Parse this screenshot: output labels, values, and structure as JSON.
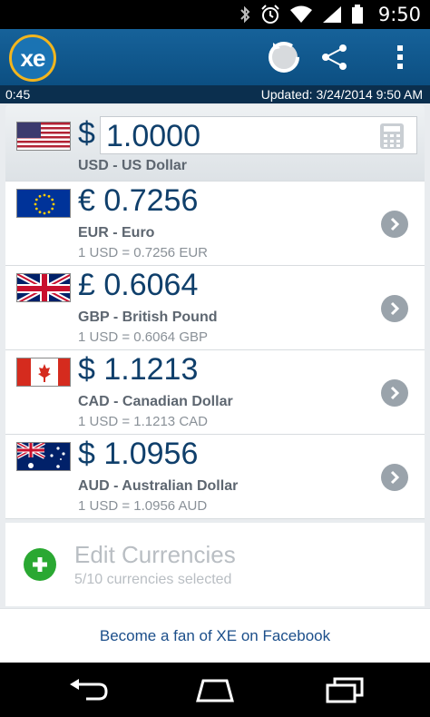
{
  "status_bar": {
    "time": "9:50"
  },
  "app_bar": {
    "logo_text": "xe"
  },
  "info_bar": {
    "left_text": "0:45",
    "updated_label": "Updated:",
    "updated_value": "3/24/2014 9:50 AM"
  },
  "base_currency": {
    "symbol": "$",
    "amount": "1.0000",
    "label": "USD - US Dollar"
  },
  "rows": [
    {
      "symbol_value": "€ 0.7256",
      "label": "EUR - Euro",
      "rate": "1 USD = 0.7256 EUR"
    },
    {
      "symbol_value": "£ 0.6064",
      "label": "GBP - British Pound",
      "rate": "1 USD = 0.6064 GBP"
    },
    {
      "symbol_value": "$ 1.1213",
      "label": "CAD - Canadian Dollar",
      "rate": "1 USD = 1.1213 CAD"
    },
    {
      "symbol_value": "$ 1.0956",
      "label": "AUD - Australian Dollar",
      "rate": "1 USD = 1.0956 AUD"
    }
  ],
  "edit": {
    "title": "Edit Currencies",
    "subtitle": "5/10 currencies selected"
  },
  "footer": {
    "link_text": "Become a fan of XE on Facebook"
  },
  "colors": {
    "appbar": "#0c4f82",
    "accent": "#f2b51d",
    "amount_text": "#0f3f6b",
    "add_green": "#2aa832"
  }
}
